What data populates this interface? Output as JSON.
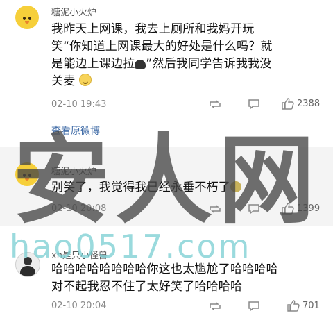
{
  "comments": [
    {
      "username": "糖泥小火炉",
      "text_lines": [
        "我昨天上网课，我去上厕所和我妈开玩",
        "笑“你知道上网课最大的好处是什么吗？就",
        "是能边上课边拉",
        "”然后我同学告诉我我没",
        "关麦"
      ],
      "time": "02-10 19:43",
      "likes": "2388",
      "link": "查看原微博"
    },
    {
      "username": "糖泥小火炉",
      "text_lines": [
        "别笑了，我觉得我已经永垂不朽了"
      ],
      "time": "02-10 20:08",
      "likes": "1399"
    },
    {
      "username": "xh是只小怪兽",
      "text_lines": [
        "哈哈哈哈哈哈哈哈你这也太尴尬了哈哈哈哈",
        "对不起我忍不住了太好笑了哈哈哈哈"
      ],
      "time": "02-10 20:04",
      "likes": "701"
    }
  ],
  "watermark": {
    "main": "安人网",
    "url": "hao0517.com"
  },
  "icons": [
    "repost-icon",
    "comment-icon",
    "thumbs-up-icon",
    "smile-emoji",
    "poop-emoji",
    "cry-emoji"
  ]
}
